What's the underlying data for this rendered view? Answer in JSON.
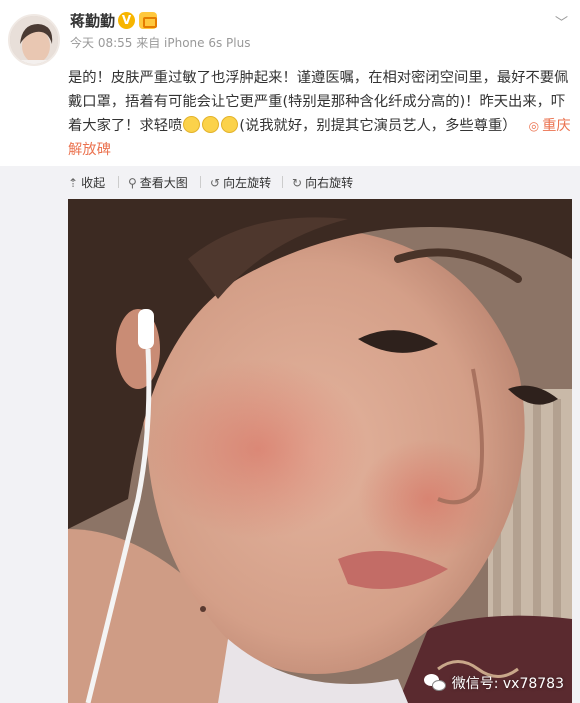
{
  "post": {
    "username": "蒋勤勤",
    "meta": "今天 08:55 来自 iPhone 6s Plus",
    "text_part1": "是的！皮肤严重过敏了也浮肿起来！谨遵医嘱，在相对密闭空间里，最好不要佩戴口罩，捂着有可能会让它更严重(特别是那种含化纤成分高的)！昨天出来，吓着大家了！求轻喷",
    "text_part2": "(说我就好，别提其它演员艺人，多些尊重）",
    "location": "重庆解放碑"
  },
  "toolbar": {
    "collapse": "收起",
    "view_large": "查看大图",
    "rotate_left": "向左旋转",
    "rotate_right": "向右旋转"
  },
  "watermark": {
    "text": "微信号: vx78783"
  },
  "icons": {
    "verified": "v-badge-icon",
    "member": "member-crown-icon",
    "caret": "chevron-down-icon",
    "location": "location-pin-icon",
    "emoji": "pray-emoji-icon"
  },
  "colors": {
    "accent_orange": "#eb7350",
    "verified_yellow": "#f7b500",
    "panel_bg": "#f2f2f5"
  }
}
